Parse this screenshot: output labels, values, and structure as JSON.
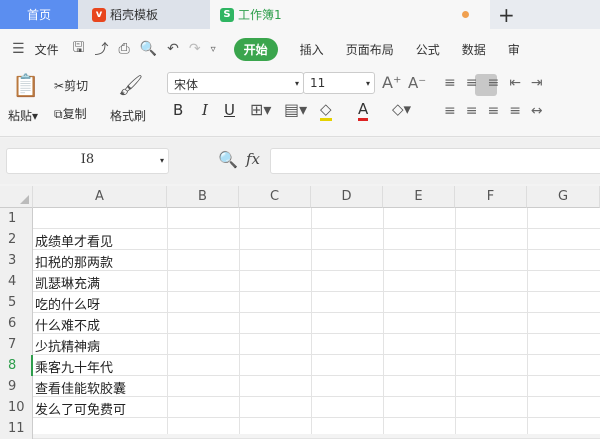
{
  "tabs": {
    "home": "首页",
    "templates": "稻壳模板",
    "workbook": "工作簿1",
    "workbook_badge": "S",
    "add": "+"
  },
  "menu": {
    "file": "文件",
    "start": "开始",
    "items": [
      "插入",
      "页面布局",
      "公式",
      "数据",
      "审"
    ]
  },
  "ribbon": {
    "paste": "粘贴",
    "cut": "剪切",
    "copy": "复制",
    "format_painter": "格式刷",
    "font_name": "宋体",
    "font_size": "11",
    "bold": "B",
    "italic": "I",
    "underline": "U",
    "font_color": "A"
  },
  "formula_bar": {
    "cell_ref": "I8",
    "fx": "fx",
    "formula": ""
  },
  "grid": {
    "columns": [
      "A",
      "B",
      "C",
      "D",
      "E",
      "F",
      "G"
    ],
    "rows": [
      {
        "n": "1",
        "a": ""
      },
      {
        "n": "2",
        "a": "成绩单才看见"
      },
      {
        "n": "3",
        "a": "扣税的那两款"
      },
      {
        "n": "4",
        "a": "凯瑟琳充满"
      },
      {
        "n": "5",
        "a": "吃的什么呀"
      },
      {
        "n": "6",
        "a": "什么难不成"
      },
      {
        "n": "7",
        "a": "少抗精神病"
      },
      {
        "n": "8",
        "a": "乘客九十年代"
      },
      {
        "n": "9",
        "a": "查看佳能软胶囊"
      },
      {
        "n": "10",
        "a": "发么了可免费可"
      },
      {
        "n": "11",
        "a": ""
      }
    ]
  },
  "colors": {
    "accent": "#3aa54d",
    "home_tab": "#5b8ef0"
  }
}
